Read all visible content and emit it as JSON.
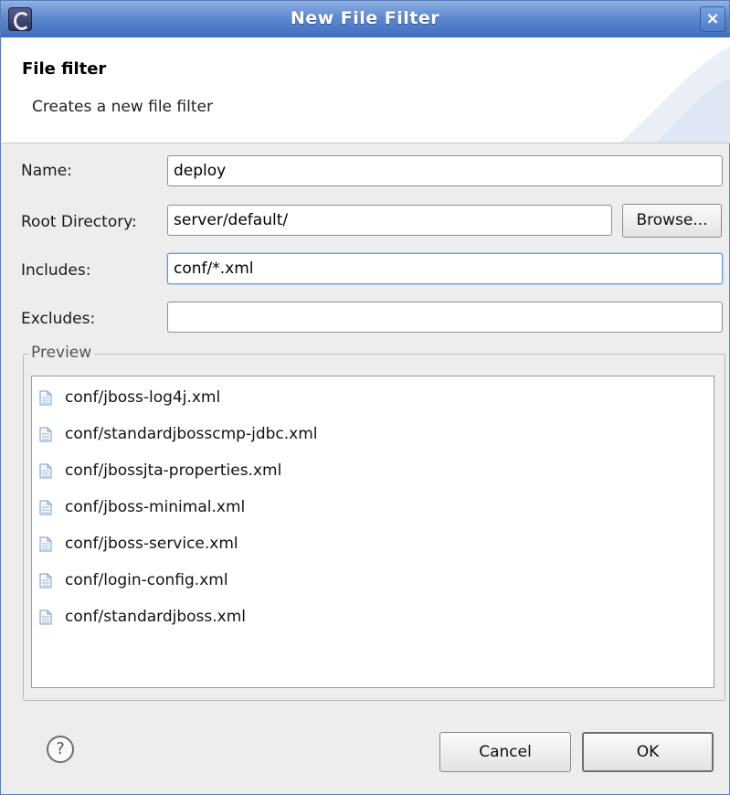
{
  "window": {
    "title": "New File Filter",
    "close_glyph": "×"
  },
  "header": {
    "title": "File filter",
    "description": "Creates a new file filter"
  },
  "form": {
    "name": {
      "label": "Name:",
      "value": "deploy"
    },
    "root_directory": {
      "label": "Root Directory:",
      "value": "server/default/",
      "browse_label": "Browse..."
    },
    "includes": {
      "label": "Includes:",
      "value": "conf/*.xml"
    },
    "excludes": {
      "label": "Excludes:",
      "value": ""
    }
  },
  "preview": {
    "label": "Preview",
    "items": [
      "conf/jboss-log4j.xml",
      "conf/standardjbosscmp-jdbc.xml",
      "conf/jbossjta-properties.xml",
      "conf/jboss-minimal.xml",
      "conf/jboss-service.xml",
      "conf/login-config.xml",
      "conf/standardjboss.xml"
    ]
  },
  "footer": {
    "help_glyph": "?",
    "cancel_label": "Cancel",
    "ok_label": "OK"
  },
  "icons": {
    "app": "eclipse-icon",
    "close": "close-icon",
    "file": "file-icon",
    "help": "help-icon"
  },
  "colors": {
    "titlebar": "#4f7bc8",
    "dialog_bg": "#ededed",
    "focus_border": "#6b9bd6"
  }
}
